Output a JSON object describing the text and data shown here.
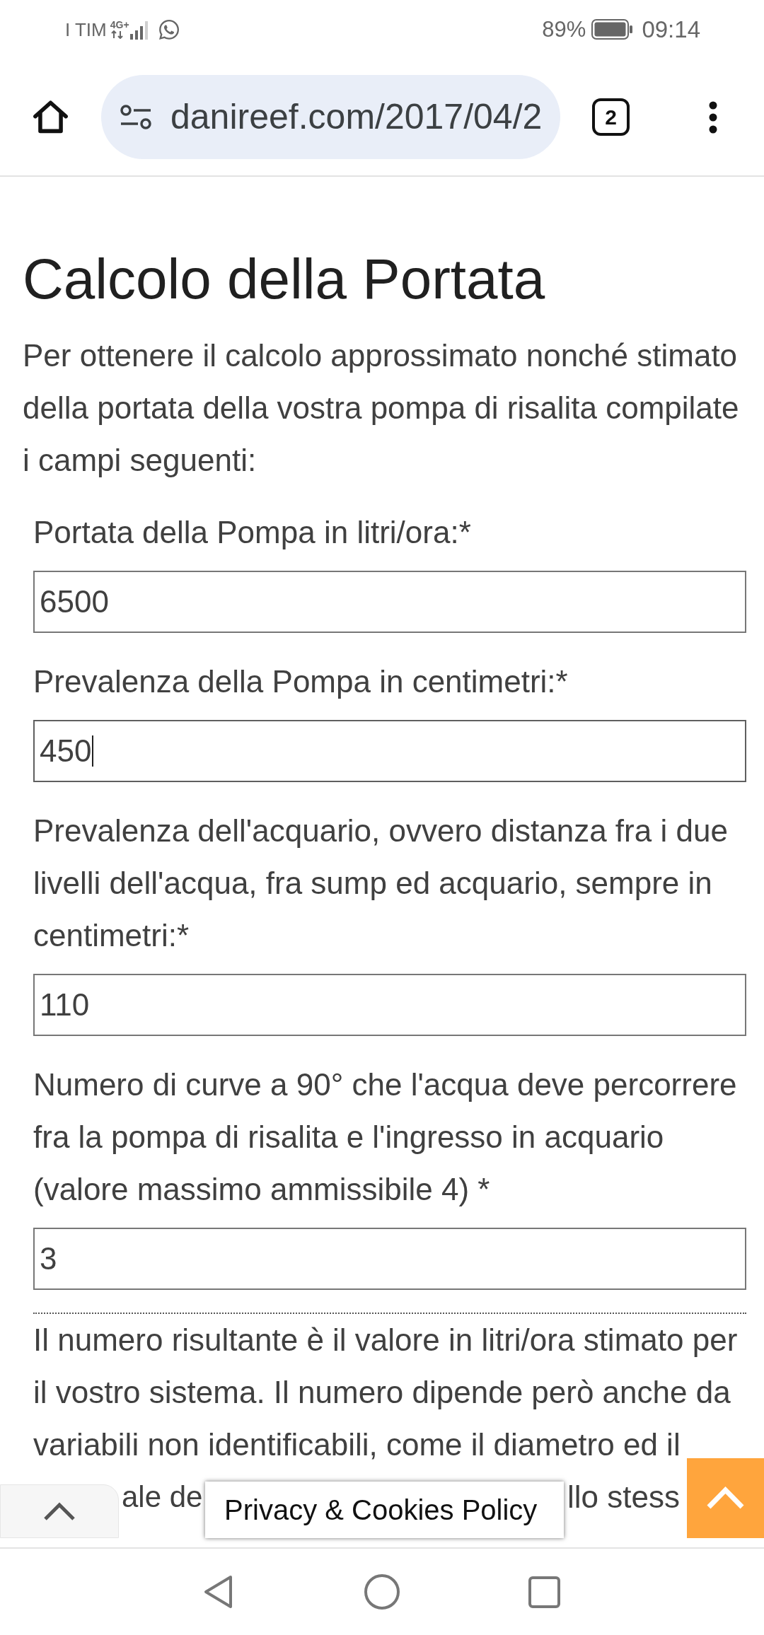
{
  "status_bar": {
    "carrier": "I TIM",
    "network_type": "4G+",
    "battery": "89%",
    "time": "09:14"
  },
  "browser_toolbar": {
    "url": "danireef.com/2017/04/2",
    "tab_count": "2"
  },
  "page": {
    "title": "Calcolo della Portata",
    "intro": "Per ottenere il calcolo approssimato nonché stimato della portata della vostra pompa di risalita compilate i campi seguenti:",
    "fields": [
      {
        "label": "Portata della Pompa in litri/ora:*",
        "value": "6500",
        "focused": false
      },
      {
        "label": "Prevalenza della Pompa in centimetri:*",
        "value": "450",
        "focused": true
      },
      {
        "label": "Prevalenza dell'acquario, ovvero distanza fra i due livelli dell'acqua, fra sump ed acquario, sempre in centimetri:*",
        "value": "110",
        "focused": false
      },
      {
        "label": "Numero di curve a 90° che l'acqua deve percorrere fra la pompa di risalita e l'ingresso in acquario (valore massimo ammissibile 4) *",
        "value": "3",
        "focused": false
      }
    ],
    "result_text": "Il numero risultante è il valore in litri/ora stimato per il vostro sistema. Il numero dipende però anche da variabili non identificabili, come il diametro ed il",
    "result_fragments": [
      "ale de",
      "llo stess"
    ]
  },
  "cookie_banner": {
    "label": "Privacy & Cookies Policy"
  }
}
